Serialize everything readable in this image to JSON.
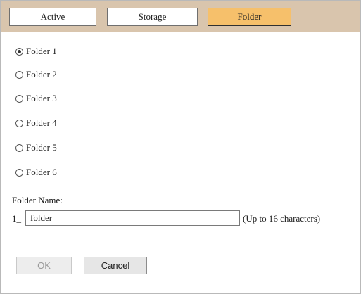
{
  "tabs": [
    {
      "label": "Active",
      "selected": false
    },
    {
      "label": "Storage",
      "selected": false
    },
    {
      "label": "Folder",
      "selected": true
    }
  ],
  "folders": [
    {
      "label": "Folder 1",
      "checked": true
    },
    {
      "label": "Folder 2",
      "checked": false
    },
    {
      "label": "Folder 3",
      "checked": false
    },
    {
      "label": "Folder 4",
      "checked": false
    },
    {
      "label": "Folder 5",
      "checked": false
    },
    {
      "label": "Folder 6",
      "checked": false
    }
  ],
  "folder_name": {
    "label": "Folder Name:",
    "prefix": "1_",
    "value": "folder",
    "hint": "(Up to 16 characters)"
  },
  "buttons": {
    "ok_label": "OK",
    "ok_enabled": false,
    "cancel_label": "Cancel"
  },
  "colors": {
    "tabbar_bg": "#d9c5ad",
    "active_tab_bg": "#f6c06b"
  }
}
